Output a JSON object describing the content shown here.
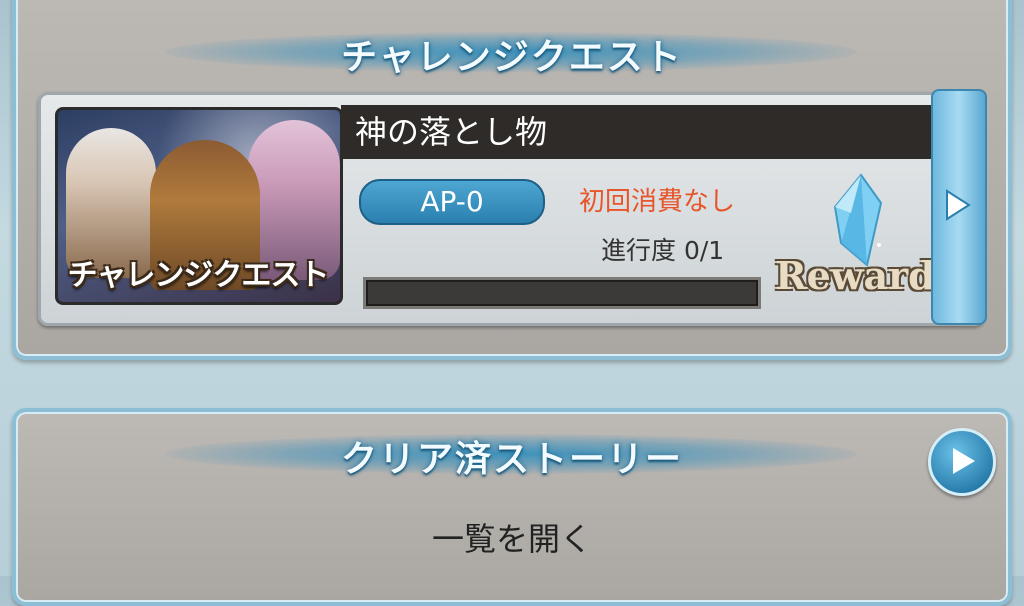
{
  "challenge_section": {
    "title": "チャレンジクエスト",
    "quest": {
      "banner_label": "チャレンジクエスト",
      "name": "神の落とし物",
      "ap_cost": "AP-0",
      "first_clear_note": "初回消費なし",
      "progress_label": "進行度 0/1",
      "progress_fraction": 0,
      "reward_label": "Reward",
      "reward_icon": "crystal-icon"
    }
  },
  "story_section": {
    "title": "クリア済ストーリー",
    "open_list_label": "一覧を開く"
  },
  "colors": {
    "accent_blue": "#2a7fae",
    "note_orange": "#e8552a",
    "panel_border": "#8cbfd6"
  }
}
